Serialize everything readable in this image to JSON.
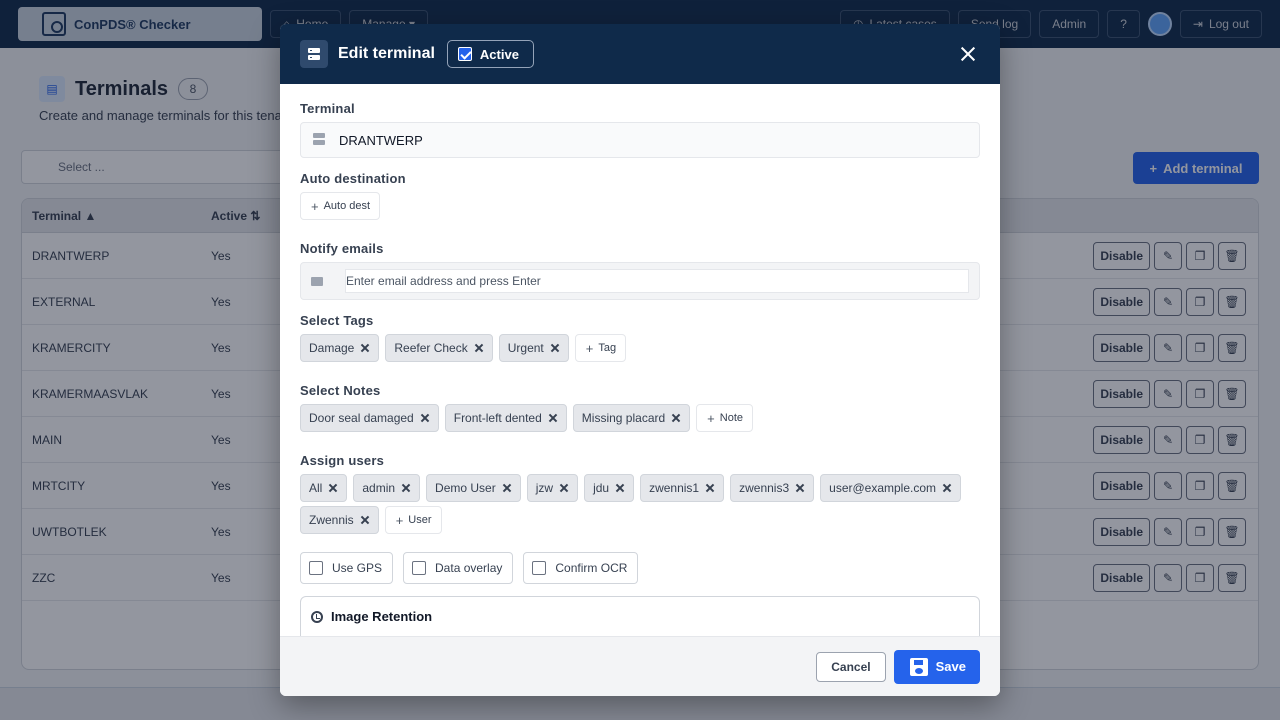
{
  "topbar": {
    "brand": "ConPDS® Checker",
    "nav": [
      {
        "label": "Home",
        "icon": "home-icon"
      },
      {
        "label": "Manage ▾",
        "icon": "menu-icon"
      },
      {
        "label": "Latest cases",
        "icon": "history-icon"
      },
      {
        "label": "Send log",
        "icon": ""
      },
      {
        "label": "Admin",
        "icon": ""
      },
      {
        "label": "Log out",
        "icon": "logout-icon"
      }
    ]
  },
  "page": {
    "title": "Terminals",
    "count": "8",
    "subtitle": "Create and manage terminals for this tenant",
    "select_placeholder": "Select ...",
    "add_label": "Add terminal",
    "table": {
      "columns": [
        "Terminal ▲",
        "Active ⇅"
      ],
      "rows": [
        [
          "DRANTWERP",
          "Yes"
        ],
        [
          "EXTERNAL",
          "Yes"
        ],
        [
          "KRAMERCITY",
          "Yes"
        ],
        [
          "KRAMERMAASVLAK",
          "Yes"
        ],
        [
          "MAIN",
          "Yes"
        ],
        [
          "MRTCITY",
          "Yes"
        ],
        [
          "UWTBOTLEK",
          "Yes"
        ],
        [
          "ZZC",
          "Yes"
        ]
      ],
      "disable_label": "Disable"
    }
  },
  "modal": {
    "title": "Edit terminal",
    "active_label": "Active",
    "terminal": {
      "label": "Terminal",
      "value": "DRANTWERP"
    },
    "auto_destination": {
      "label": "Auto destination",
      "button": "Auto dest"
    },
    "notify_emails": {
      "label": "Notify emails",
      "placeholder": "Enter email address and press Enter"
    },
    "tags": {
      "label": "Select Tags",
      "items": [
        "Damage",
        "Reefer Check",
        "Urgent"
      ],
      "add": "Tag"
    },
    "notes": {
      "label": "Select Notes",
      "items": [
        "Door seal damaged",
        "Front-left dented",
        "Missing placard"
      ],
      "add": "Note"
    },
    "users": {
      "label": "Assign users",
      "items": [
        "All",
        "admin",
        "Demo User",
        "jzw",
        "jdu",
        "zwennis1",
        "zwennis3",
        "user@example.com",
        "Zwennis"
      ],
      "add": "User"
    },
    "options": [
      "Use GPS",
      "Data overlay",
      "Confirm OCR"
    ],
    "retention": {
      "title": "Image Retention"
    },
    "cancel_label": "Cancel",
    "save_label": "Save"
  },
  "colors": {
    "primary": "#2563eb",
    "header": "#0f2a4a"
  }
}
